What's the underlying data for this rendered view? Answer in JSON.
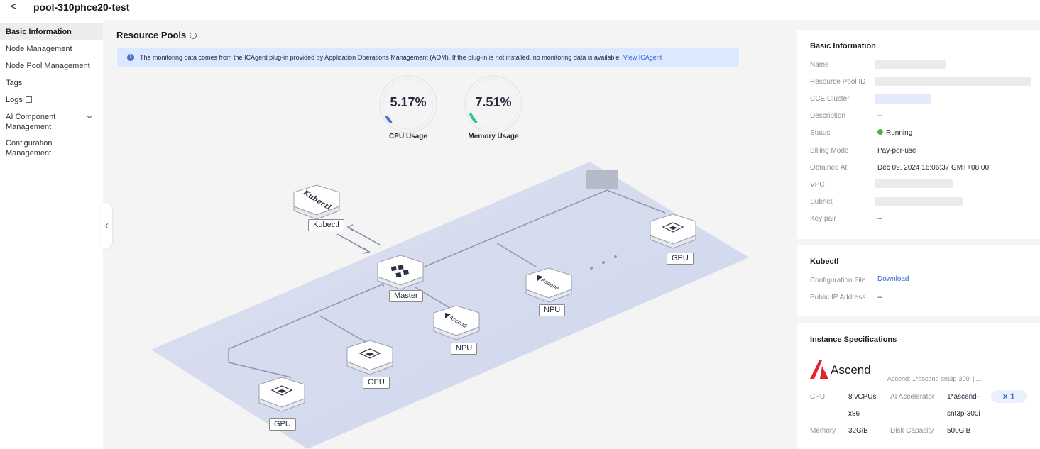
{
  "header": {
    "back_label": "<",
    "title": "pool-310phce20-test"
  },
  "sidebar": {
    "items": [
      {
        "label": "Basic Information"
      },
      {
        "label": "Node Management"
      },
      {
        "label": "Node Pool Management"
      },
      {
        "label": "Tags"
      },
      {
        "label": "Logs"
      },
      {
        "label": "AI Component",
        "label2": "Management"
      },
      {
        "label": "Configuration",
        "label2": "Management"
      }
    ]
  },
  "main": {
    "title": "Resource Pools",
    "banner": {
      "text": "The monitoring data comes from the ICAgent plug-in provided by Application Operations Management (AOM). If the plug-in is not installed, no monitoring data is available.",
      "link": "View ICAgent"
    },
    "gauges": [
      {
        "value_text": "5.17%",
        "value": 5.17,
        "label": "CPU Usage",
        "color": "#526ecc"
      },
      {
        "value_text": "7.51%",
        "value": 7.51,
        "label": "Memory Usage",
        "color": "#3ac29c"
      }
    ],
    "topology": {
      "kubectl": "Kubectl",
      "master": "Master",
      "npu1": "NPU",
      "npu2": "NPU",
      "gpu1": "GPU",
      "gpu2": "GPU",
      "gpu3": "GPU",
      "icon_text_kubectl": "Kubectl",
      "icon_text_ascend": "Ascend"
    }
  },
  "basic_info": {
    "title": "Basic Information",
    "rows": [
      {
        "key": "Name",
        "value": ""
      },
      {
        "key": "Resource Pool ID",
        "value": ""
      },
      {
        "key": "CCE Cluster",
        "value": ""
      },
      {
        "key": "Description",
        "value": "--"
      },
      {
        "key": "Status",
        "value": "Running"
      },
      {
        "key": "Billing Mode",
        "value": "Pay-per-use"
      },
      {
        "key": "Obtained At",
        "value": "Dec 09, 2024 16:06:37 GMT+08:00"
      },
      {
        "key": "VPC",
        "value": ""
      },
      {
        "key": "Subnet",
        "value": ""
      },
      {
        "key": "Key pair",
        "value": "--"
      }
    ]
  },
  "kubectl_card": {
    "title": "Kubectl",
    "config_key": "Configuration File",
    "config_value": "Download",
    "ip_key": "Public IP Address",
    "ip_value": "--"
  },
  "instance": {
    "title": "Instance Specifications",
    "brand": "Ascend",
    "spec_summary": "Ascend: 1*ascend-snt3p-300i | ...",
    "cpu_key": "CPU",
    "cpu_value": "8 vCPUs",
    "arch": "x86",
    "accel_key": "AI Accelerator",
    "accel_value1": "1*ascend-",
    "accel_value2": "snt3p-300i",
    "memory_key": "Memory",
    "memory_value": "32GiB",
    "disk_key": "Disk Capacity",
    "disk_value": "500GiB",
    "count": "× 1"
  },
  "colors": {
    "accent": "#3069d6",
    "banner_bg": "#dbe8ff",
    "running": "#4caf50",
    "ascend_red": "#e3242b"
  }
}
